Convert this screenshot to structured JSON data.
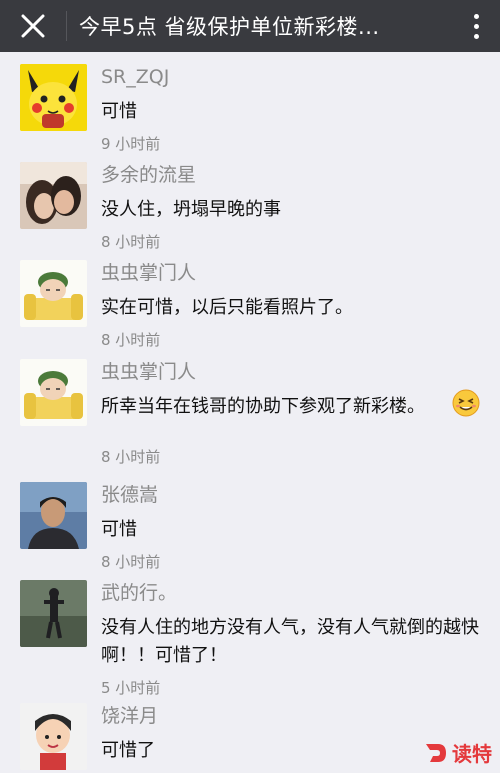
{
  "header": {
    "title": "今早5点 省级保护单位新彩楼..."
  },
  "comments": [
    {
      "name": "SR_ZQJ",
      "text": "可惜",
      "time": "9 小时前",
      "avatar": "pikachu-avatar"
    },
    {
      "name": "多余的流星",
      "text": "没人住，坍塌早晚的事",
      "time": "8 小时前",
      "avatar": "couple-photo-avatar"
    },
    {
      "name": "虫虫掌门人",
      "text": "实在可惜，以后只能看照片了。",
      "time": "8 小时前",
      "avatar": "cartoon-sofa-avatar"
    },
    {
      "name": "虫虫掌门人",
      "text": "所幸当年在钱哥的协助下参观了新彩楼。",
      "time": "8 小时前",
      "avatar": "cartoon-sofa-avatar",
      "emoji": "grin-emoji"
    },
    {
      "name": "张德嵩",
      "text": "可惜",
      "time": "8 小时前",
      "avatar": "man-photo-avatar"
    },
    {
      "name": "武的行。",
      "text": "没有人住的地方没有人气，没有人气就倒的越快啊！！可惜了！",
      "time": "5 小时前",
      "avatar": "outdoor-photo-avatar"
    },
    {
      "name": "饶洋月",
      "text": "可惜了",
      "time": "",
      "avatar": "cartoon-boy-avatar"
    }
  ],
  "watermark": {
    "brand": "读特"
  },
  "colors": {
    "topbar": "#393a3f",
    "background": "#efeff4",
    "meta_text": "#8a8a8a",
    "brand_red": "#e4393c"
  }
}
